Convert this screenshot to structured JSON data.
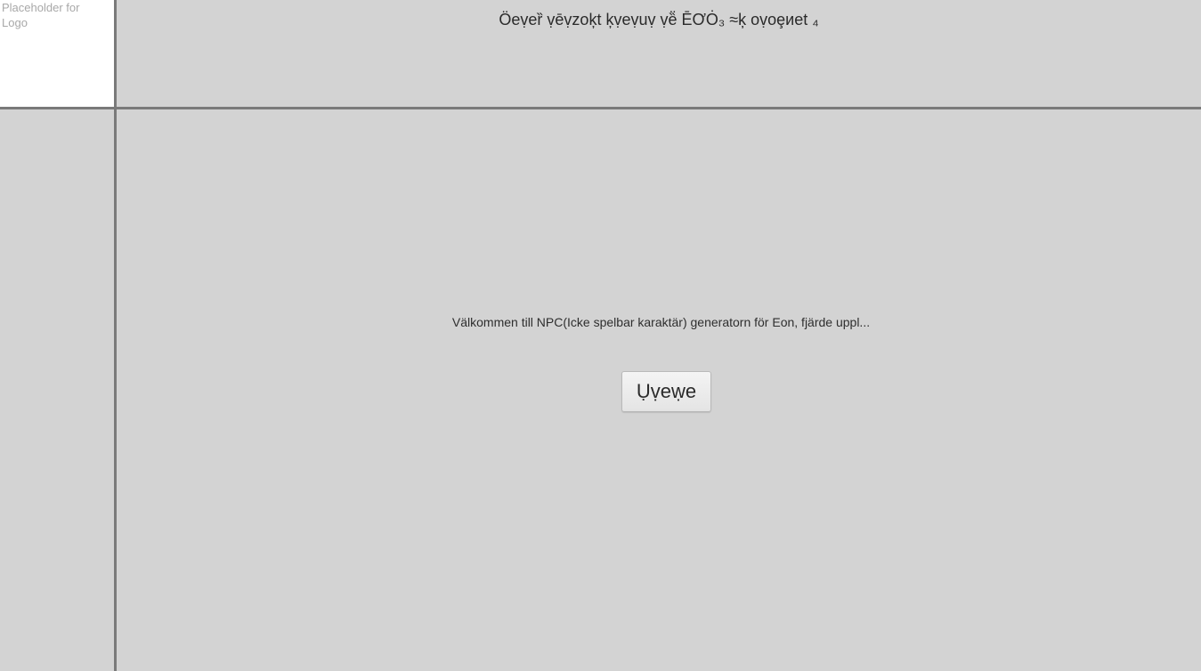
{
  "logo": {
    "placeholder_text": "Placeholder for Logo"
  },
  "header": {
    "title": "Öeṿeȑ ṿēṿzoķt ķṿeṿuṿ ṿȅ̈ ĒƠȮ₃ ≈ķ oṿoȩиet ₄"
  },
  "main": {
    "welcome_text": "Välkommen till NPC(Icke spelbar karaktär) generatorn för Eon, fjärde uppl...",
    "start_button_label": "Ụṿeẉe"
  },
  "colors": {
    "background": "#d3d3d3",
    "divider": "#7a7a7a",
    "logo_background": "#ffffff",
    "logo_text": "#a8a8a8"
  }
}
